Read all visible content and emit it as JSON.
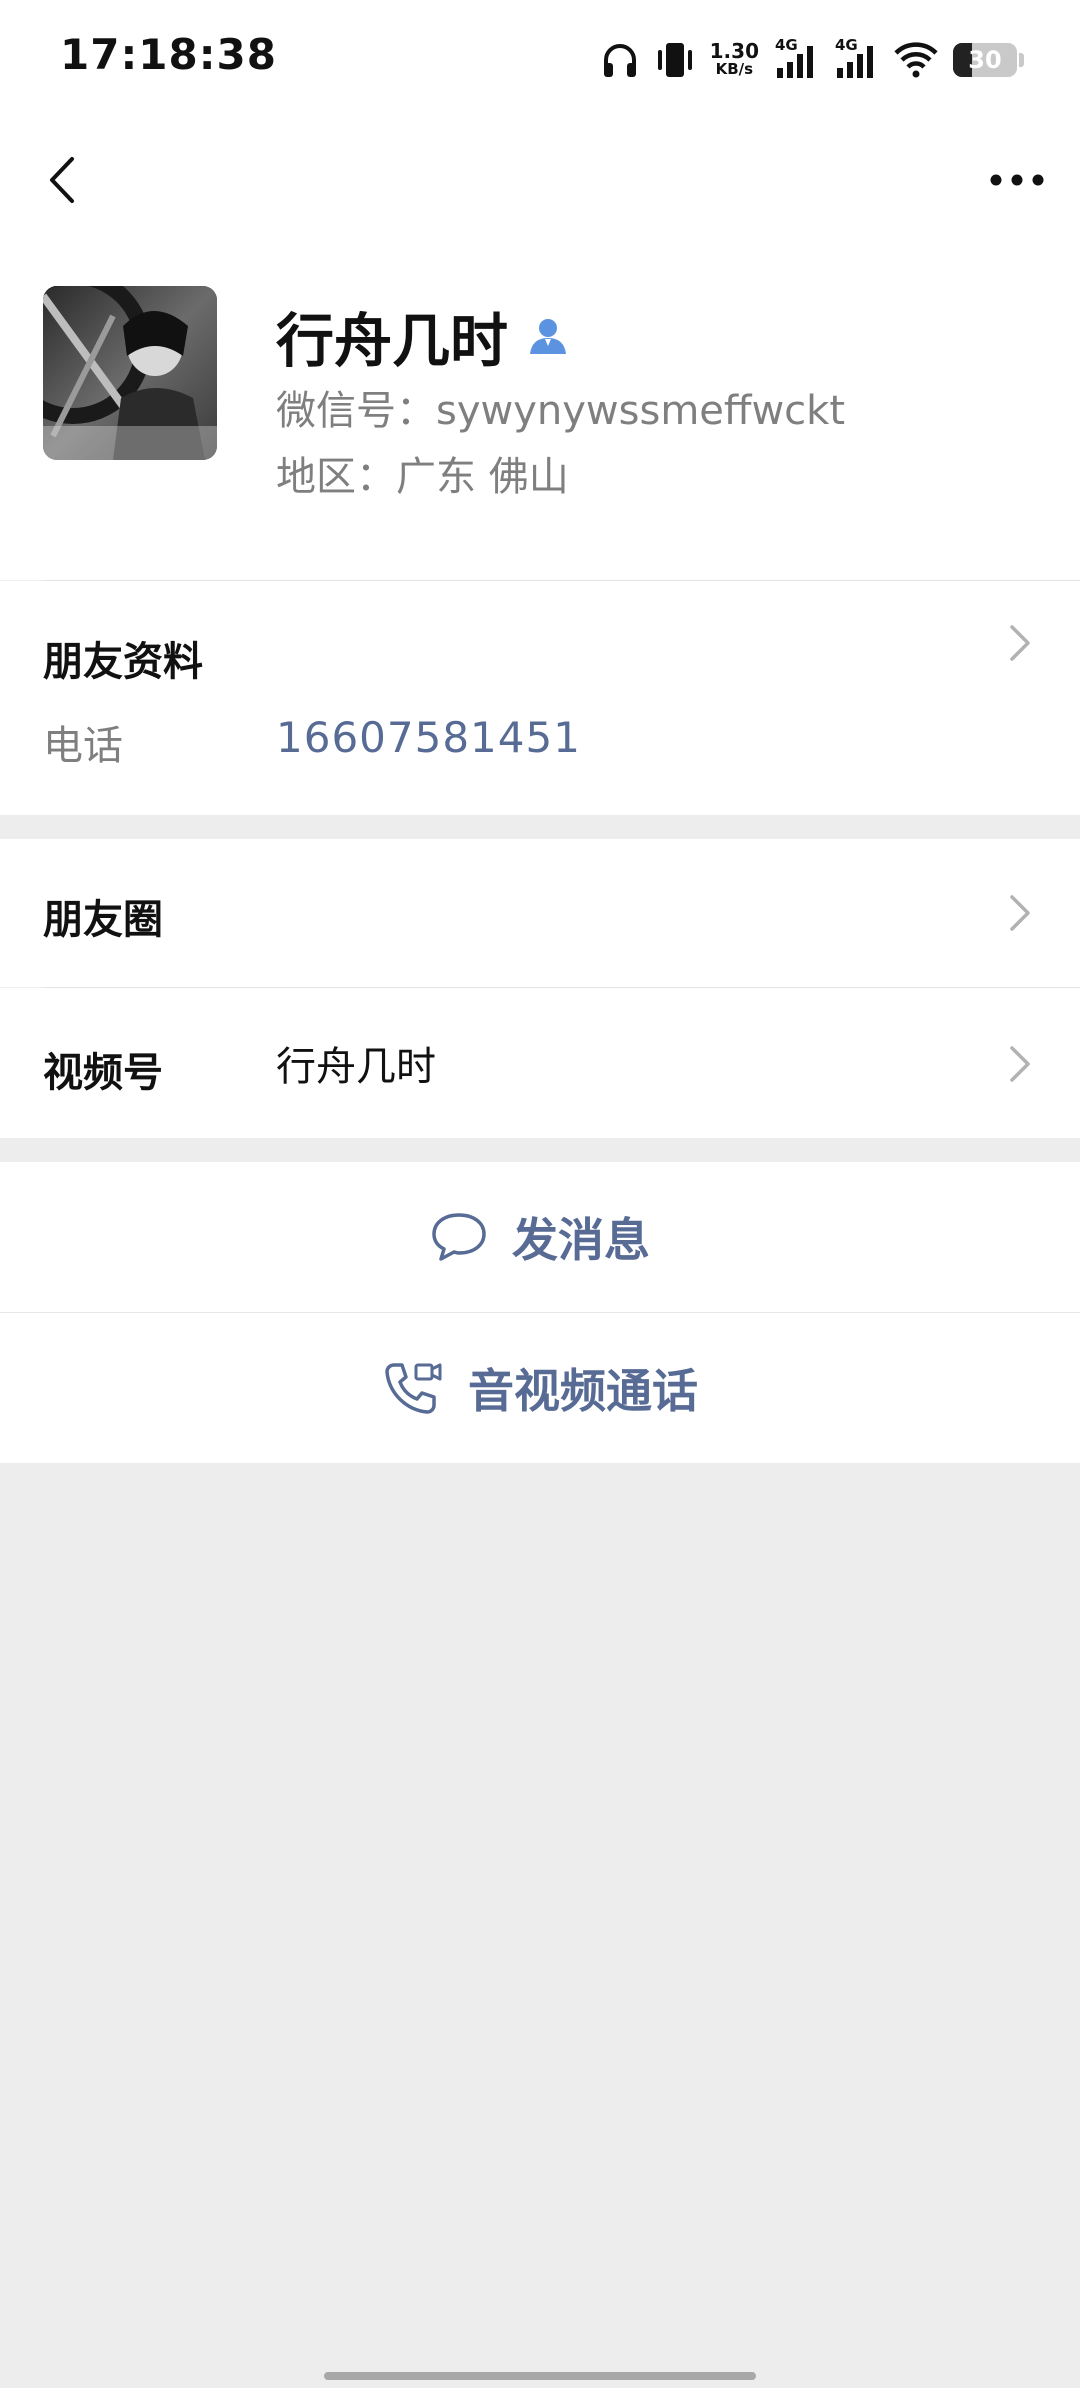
{
  "status_bar": {
    "time": "17:18:38",
    "net_speed_value": "1.30",
    "net_speed_unit": "KB/s",
    "signal_1_tag": "4G",
    "signal_2_tag": "4G",
    "battery_level": "30",
    "icons": [
      "headphones-icon",
      "vibrate-icon",
      "signal-icon",
      "signal-icon",
      "wifi-icon",
      "battery-icon"
    ]
  },
  "nav": {
    "back_icon": "chevron-left-icon",
    "more_icon": "more-dots-icon"
  },
  "profile": {
    "name": "行舟几时",
    "badge_icon": "person-icon",
    "wechat_id": "微信号：sywynywssmeffwckt",
    "region": "地区：广东  佛山"
  },
  "friend_info": {
    "title": "朋友资料",
    "phone_label": "电话",
    "phone_value": "16607581451"
  },
  "moments": {
    "label": "朋友圈"
  },
  "channels": {
    "label": "视频号",
    "value": "行舟几时"
  },
  "actions": {
    "message_label": "发消息",
    "call_label": "音视频通话"
  },
  "colors": {
    "link": "#576b95",
    "secondary_text": "#7f7f7f",
    "background": "#ededed",
    "badge": "#5b93e0"
  }
}
